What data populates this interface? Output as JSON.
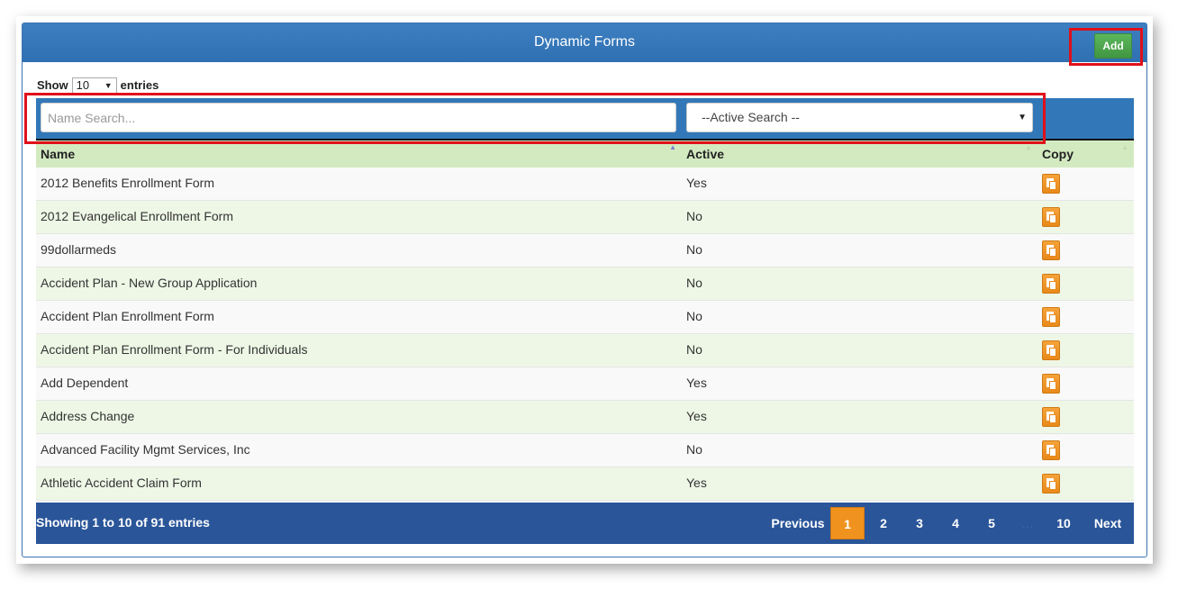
{
  "header": {
    "title": "Dynamic Forms",
    "add_label": "Add"
  },
  "length": {
    "show_label": "Show",
    "value": "10",
    "entries_label": "entries"
  },
  "filters": {
    "name_placeholder": "Name Search...",
    "active_value": "--Active Search --"
  },
  "table": {
    "columns": [
      "Name",
      "Active",
      "Copy"
    ],
    "rows": [
      {
        "name": "2012 Benefits Enrollment Form",
        "active": "Yes"
      },
      {
        "name": "2012 Evangelical Enrollment Form",
        "active": "No"
      },
      {
        "name": "99dollarmeds",
        "active": "No"
      },
      {
        "name": "Accident Plan - New Group Application",
        "active": "No"
      },
      {
        "name": "Accident Plan Enrollment Form",
        "active": "No"
      },
      {
        "name": "Accident Plan Enrollment Form - For Individuals",
        "active": "No"
      },
      {
        "name": "Add Dependent",
        "active": "Yes"
      },
      {
        "name": "Address Change",
        "active": "Yes"
      },
      {
        "name": "Advanced Facility Mgmt Services, Inc",
        "active": "No"
      },
      {
        "name": "Athletic Accident Claim Form",
        "active": "Yes"
      }
    ]
  },
  "footer": {
    "info": "Showing 1 to 10 of 91 entries",
    "previous": "Previous",
    "pages": [
      "1",
      "2",
      "3",
      "4",
      "5"
    ],
    "ellipsis": "…",
    "last": "10",
    "next": "Next"
  },
  "colors": {
    "header": "#3278b8",
    "add": "#4cae4c",
    "copy": "#f0921e",
    "footer": "#2a5599",
    "highlight": "#e0101a"
  },
  "icons": {
    "copy": "copy-icon"
  }
}
